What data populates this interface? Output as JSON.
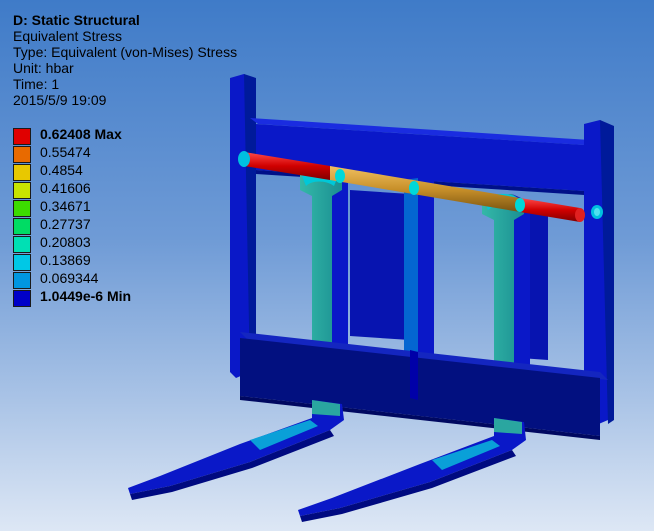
{
  "header": {
    "title": "D: Static Structural",
    "result": "Equivalent Stress",
    "type": "Type: Equivalent (von-Mises) Stress",
    "unit": "Unit: hbar",
    "time": "Time: 1",
    "timestamp": "2015/5/9 19:09"
  },
  "legend": {
    "entries": [
      {
        "label": "0.62408 Max",
        "color": "#e00000",
        "bold": true
      },
      {
        "label": "0.55474",
        "color": "#e86a00",
        "bold": false
      },
      {
        "label": "0.4854",
        "color": "#e8c800",
        "bold": false
      },
      {
        "label": "0.41606",
        "color": "#c8e400",
        "bold": false
      },
      {
        "label": "0.34671",
        "color": "#3cdc00",
        "bold": false
      },
      {
        "label": "0.27737",
        "color": "#00dc64",
        "bold": false
      },
      {
        "label": "0.20803",
        "color": "#00e0b4",
        "bold": false
      },
      {
        "label": "0.13869",
        "color": "#00c8e6",
        "bold": false
      },
      {
        "label": "0.069344",
        "color": "#0096e0",
        "bold": false
      },
      {
        "label": "1.0449e-6 Min",
        "color": "#0000c8",
        "bold": true
      }
    ]
  },
  "model": {
    "name": "pallet-fork-attachment",
    "colors": {
      "frame": "#0a18c8",
      "frame_dark": "#001090",
      "frame_shadow": "#001080",
      "fork_arm": "#1f9b9b",
      "fork_arm_light": "#33b9a5",
      "rod_high": "#e00000",
      "rod_mid": "#c89a20",
      "hotspot": "#00d0e0"
    }
  }
}
